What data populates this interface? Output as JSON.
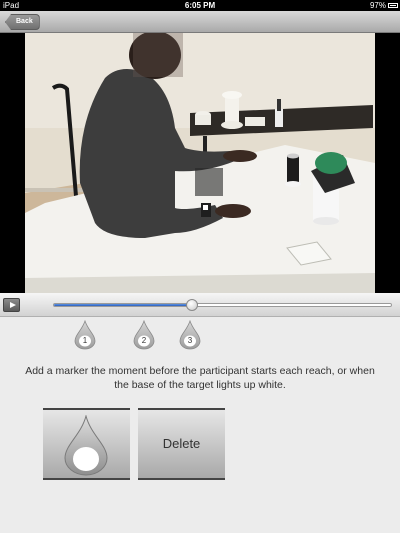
{
  "status_bar": {
    "carrier": "iPad",
    "time": "6:05 PM",
    "battery": "97%"
  },
  "nav": {
    "back_label": "Back"
  },
  "video": {
    "progress": 0.41
  },
  "markers": [
    {
      "label": "1"
    },
    {
      "label": "2"
    },
    {
      "label": "3"
    }
  ],
  "instructions": "Add a marker the moment before the participant starts each reach, or when the base of the target lights up white.",
  "buttons": {
    "add_marker_icon": "teardrop-marker-icon",
    "delete_label": "Delete"
  },
  "colors": {
    "scrub_fill": "#3a6fd0",
    "status_bar": "#000000"
  }
}
